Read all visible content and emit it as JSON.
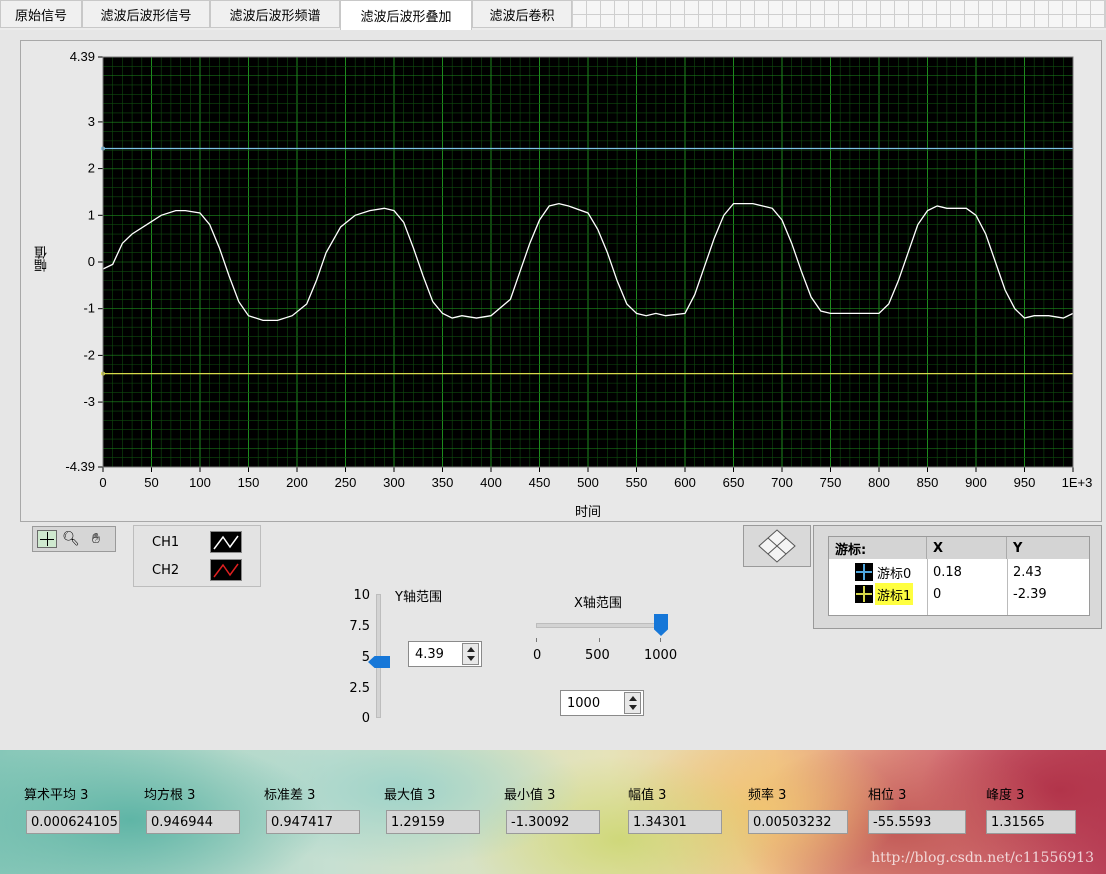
{
  "tabs": [
    "原始信号",
    "滤波后波形信号",
    "滤波后波形频谱",
    "滤波后波形叠加",
    "滤波后卷积"
  ],
  "active_tab": 3,
  "graph": {
    "ylabel": "幅值",
    "xlabel": "时间",
    "y_ticks": [
      "4.39",
      "3",
      "2",
      "1",
      "0",
      "-1",
      "-2",
      "-3",
      "-4.39"
    ],
    "x_ticks": [
      "0",
      "50",
      "100",
      "150",
      "200",
      "250",
      "300",
      "350",
      "400",
      "450",
      "500",
      "550",
      "600",
      "650",
      "700",
      "750",
      "800",
      "850",
      "900",
      "950",
      "1E+3"
    ]
  },
  "chart_data": {
    "type": "line",
    "xlabel": "时间",
    "ylabel": "幅值",
    "xlim": [
      0,
      1000
    ],
    "ylim": [
      -4.39,
      4.39
    ],
    "grid": true,
    "series": [
      {
        "x": [
          0,
          10,
          20,
          30,
          45,
          60,
          75,
          85,
          100,
          110,
          120,
          130,
          140,
          150,
          165,
          180,
          195,
          210,
          220,
          230,
          245,
          260,
          275,
          290,
          300,
          310,
          320,
          330,
          340,
          350,
          360,
          370,
          385,
          400,
          420,
          430,
          440,
          450,
          460,
          470,
          480,
          500,
          510,
          520,
          530,
          540,
          550,
          560,
          570,
          580,
          600,
          610,
          620,
          630,
          640,
          650,
          660,
          670,
          690,
          700,
          710,
          720,
          730,
          740,
          750,
          760,
          770,
          800,
          810,
          820,
          830,
          840,
          850,
          860,
          870,
          890,
          900,
          910,
          920,
          930,
          940,
          950,
          960,
          975,
          990,
          1000
        ],
        "y": [
          -0.15,
          -0.05,
          0.4,
          0.6,
          0.8,
          1.0,
          1.1,
          1.1,
          1.05,
          0.8,
          0.3,
          -0.3,
          -0.85,
          -1.15,
          -1.25,
          -1.25,
          -1.15,
          -0.9,
          -0.4,
          0.2,
          0.75,
          1.0,
          1.1,
          1.15,
          1.1,
          0.85,
          0.3,
          -0.3,
          -0.85,
          -1.1,
          -1.2,
          -1.15,
          -1.2,
          -1.15,
          -0.8,
          -0.2,
          0.4,
          0.9,
          1.2,
          1.25,
          1.2,
          1.05,
          0.7,
          0.2,
          -0.4,
          -0.9,
          -1.1,
          -1.15,
          -1.1,
          -1.15,
          -1.1,
          -0.7,
          -0.1,
          0.5,
          1.0,
          1.25,
          1.25,
          1.25,
          1.15,
          0.9,
          0.4,
          -0.2,
          -0.75,
          -1.05,
          -1.1,
          -1.1,
          -1.1,
          -1.1,
          -0.9,
          -0.4,
          0.2,
          0.8,
          1.1,
          1.2,
          1.15,
          1.15,
          1.0,
          0.6,
          0.0,
          -0.6,
          -1.0,
          -1.2,
          -1.15,
          -1.15,
          -1.2,
          -1.1
        ],
        "color": "#ffffff"
      },
      {
        "x": [
          0,
          1000
        ],
        "y": [
          2.43,
          2.43
        ],
        "color": "#7cc0e6"
      },
      {
        "x": [
          0,
          1000
        ],
        "y": [
          -2.39,
          -2.39
        ],
        "color": "#d6d84a"
      }
    ]
  },
  "legend": {
    "items": [
      {
        "label": "CH1",
        "color": "#ffffff"
      },
      {
        "label": "CH2",
        "color": "#e02020"
      }
    ]
  },
  "cursor": {
    "headers": [
      "游标:",
      "X",
      "Y"
    ],
    "rows": [
      {
        "name": "游标0",
        "x": "0.18",
        "y": "2.43"
      },
      {
        "name": "游标1",
        "x": "0",
        "y": "-2.39"
      }
    ]
  },
  "y_range": {
    "title": "Y轴范围",
    "ticks": [
      "10",
      "7.5",
      "5",
      "2.5",
      "0"
    ],
    "value": "4.39",
    "slider_level": 0.439
  },
  "x_range": {
    "title": "X轴范围",
    "ticks": [
      "0",
      "500",
      "1000"
    ],
    "value": "1000",
    "slider_level": 1.0
  },
  "stats": [
    {
      "label": "算术平均 3",
      "value": "0.000624105"
    },
    {
      "label": "均方根 3",
      "value": "0.946944"
    },
    {
      "label": "标准差 3",
      "value": "0.947417"
    },
    {
      "label": "最大值 3",
      "value": "1.29159"
    },
    {
      "label": "最小值 3",
      "value": "-1.30092"
    },
    {
      "label": "幅值 3",
      "value": "1.34301"
    },
    {
      "label": "频率 3",
      "value": "0.00503232"
    },
    {
      "label": "相位 3",
      "value": "-55.5593"
    },
    {
      "label": "峰度 3",
      "value": "1.31565"
    }
  ],
  "watermark": "http://blog.csdn.net/c11556913"
}
